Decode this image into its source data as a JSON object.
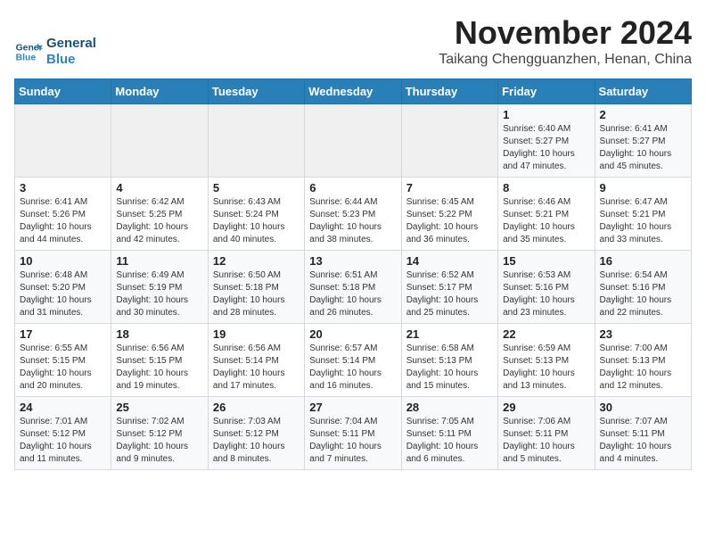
{
  "logo": {
    "line1": "General",
    "line2": "Blue"
  },
  "title": "November 2024",
  "location": "Taikang Chengguanzhen, Henan, China",
  "weekdays": [
    "Sunday",
    "Monday",
    "Tuesday",
    "Wednesday",
    "Thursday",
    "Friday",
    "Saturday"
  ],
  "weeks": [
    [
      {
        "day": "",
        "info": ""
      },
      {
        "day": "",
        "info": ""
      },
      {
        "day": "",
        "info": ""
      },
      {
        "day": "",
        "info": ""
      },
      {
        "day": "",
        "info": ""
      },
      {
        "day": "1",
        "info": "Sunrise: 6:40 AM\nSunset: 5:27 PM\nDaylight: 10 hours\nand 47 minutes."
      },
      {
        "day": "2",
        "info": "Sunrise: 6:41 AM\nSunset: 5:27 PM\nDaylight: 10 hours\nand 45 minutes."
      }
    ],
    [
      {
        "day": "3",
        "info": "Sunrise: 6:41 AM\nSunset: 5:26 PM\nDaylight: 10 hours\nand 44 minutes."
      },
      {
        "day": "4",
        "info": "Sunrise: 6:42 AM\nSunset: 5:25 PM\nDaylight: 10 hours\nand 42 minutes."
      },
      {
        "day": "5",
        "info": "Sunrise: 6:43 AM\nSunset: 5:24 PM\nDaylight: 10 hours\nand 40 minutes."
      },
      {
        "day": "6",
        "info": "Sunrise: 6:44 AM\nSunset: 5:23 PM\nDaylight: 10 hours\nand 38 minutes."
      },
      {
        "day": "7",
        "info": "Sunrise: 6:45 AM\nSunset: 5:22 PM\nDaylight: 10 hours\nand 36 minutes."
      },
      {
        "day": "8",
        "info": "Sunrise: 6:46 AM\nSunset: 5:21 PM\nDaylight: 10 hours\nand 35 minutes."
      },
      {
        "day": "9",
        "info": "Sunrise: 6:47 AM\nSunset: 5:21 PM\nDaylight: 10 hours\nand 33 minutes."
      }
    ],
    [
      {
        "day": "10",
        "info": "Sunrise: 6:48 AM\nSunset: 5:20 PM\nDaylight: 10 hours\nand 31 minutes."
      },
      {
        "day": "11",
        "info": "Sunrise: 6:49 AM\nSunset: 5:19 PM\nDaylight: 10 hours\nand 30 minutes."
      },
      {
        "day": "12",
        "info": "Sunrise: 6:50 AM\nSunset: 5:18 PM\nDaylight: 10 hours\nand 28 minutes."
      },
      {
        "day": "13",
        "info": "Sunrise: 6:51 AM\nSunset: 5:18 PM\nDaylight: 10 hours\nand 26 minutes."
      },
      {
        "day": "14",
        "info": "Sunrise: 6:52 AM\nSunset: 5:17 PM\nDaylight: 10 hours\nand 25 minutes."
      },
      {
        "day": "15",
        "info": "Sunrise: 6:53 AM\nSunset: 5:16 PM\nDaylight: 10 hours\nand 23 minutes."
      },
      {
        "day": "16",
        "info": "Sunrise: 6:54 AM\nSunset: 5:16 PM\nDaylight: 10 hours\nand 22 minutes."
      }
    ],
    [
      {
        "day": "17",
        "info": "Sunrise: 6:55 AM\nSunset: 5:15 PM\nDaylight: 10 hours\nand 20 minutes."
      },
      {
        "day": "18",
        "info": "Sunrise: 6:56 AM\nSunset: 5:15 PM\nDaylight: 10 hours\nand 19 minutes."
      },
      {
        "day": "19",
        "info": "Sunrise: 6:56 AM\nSunset: 5:14 PM\nDaylight: 10 hours\nand 17 minutes."
      },
      {
        "day": "20",
        "info": "Sunrise: 6:57 AM\nSunset: 5:14 PM\nDaylight: 10 hours\nand 16 minutes."
      },
      {
        "day": "21",
        "info": "Sunrise: 6:58 AM\nSunset: 5:13 PM\nDaylight: 10 hours\nand 15 minutes."
      },
      {
        "day": "22",
        "info": "Sunrise: 6:59 AM\nSunset: 5:13 PM\nDaylight: 10 hours\nand 13 minutes."
      },
      {
        "day": "23",
        "info": "Sunrise: 7:00 AM\nSunset: 5:13 PM\nDaylight: 10 hours\nand 12 minutes."
      }
    ],
    [
      {
        "day": "24",
        "info": "Sunrise: 7:01 AM\nSunset: 5:12 PM\nDaylight: 10 hours\nand 11 minutes."
      },
      {
        "day": "25",
        "info": "Sunrise: 7:02 AM\nSunset: 5:12 PM\nDaylight: 10 hours\nand 9 minutes."
      },
      {
        "day": "26",
        "info": "Sunrise: 7:03 AM\nSunset: 5:12 PM\nDaylight: 10 hours\nand 8 minutes."
      },
      {
        "day": "27",
        "info": "Sunrise: 7:04 AM\nSunset: 5:11 PM\nDaylight: 10 hours\nand 7 minutes."
      },
      {
        "day": "28",
        "info": "Sunrise: 7:05 AM\nSunset: 5:11 PM\nDaylight: 10 hours\nand 6 minutes."
      },
      {
        "day": "29",
        "info": "Sunrise: 7:06 AM\nSunset: 5:11 PM\nDaylight: 10 hours\nand 5 minutes."
      },
      {
        "day": "30",
        "info": "Sunrise: 7:07 AM\nSunset: 5:11 PM\nDaylight: 10 hours\nand 4 minutes."
      }
    ]
  ]
}
